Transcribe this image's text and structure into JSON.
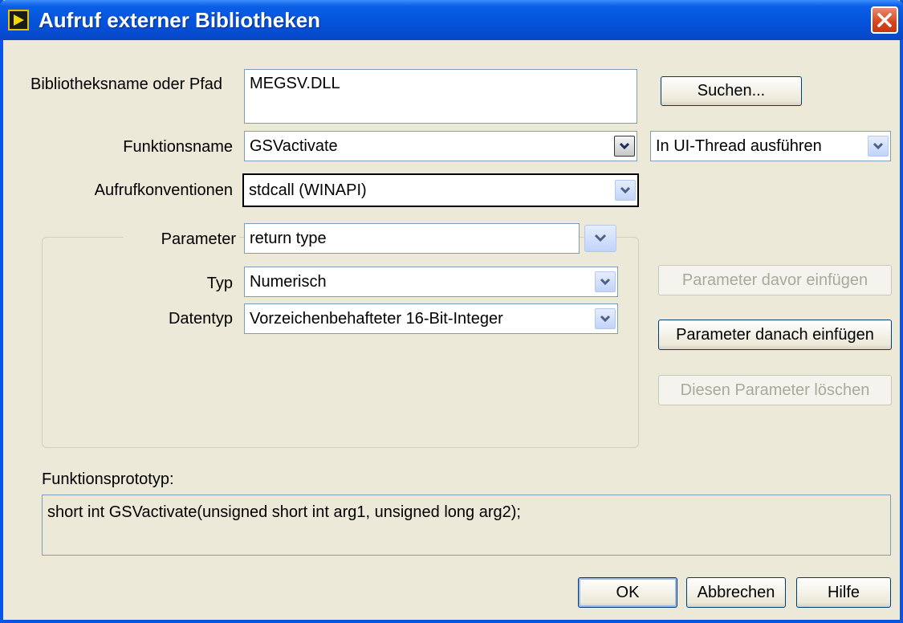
{
  "window": {
    "title": "Aufruf externer Bibliotheken"
  },
  "library": {
    "label": "Bibliotheksname oder Pfad",
    "value": "MEGSV.DLL",
    "browse_label": "Suchen..."
  },
  "function": {
    "label": "Funktionsname",
    "value": "GSVactivate",
    "thread_value": "In UI-Thread ausführen"
  },
  "calling": {
    "label": "Aufrufkonventionen",
    "value": "stdcall (WINAPI)"
  },
  "parameter": {
    "label": "Parameter",
    "value": "return type"
  },
  "type": {
    "label": "Typ",
    "value": "Numerisch"
  },
  "datatype": {
    "label": "Datentyp",
    "value": "Vorzeichenbehafteter 16-Bit-Integer"
  },
  "buttons": {
    "insert_before": "Parameter davor einfügen",
    "insert_after": "Parameter danach einfügen",
    "delete": "Diesen Parameter löschen",
    "ok": "OK",
    "cancel": "Abbrechen",
    "help": "Hilfe"
  },
  "prototype": {
    "label": "Funktionsprototyp:",
    "value": "short int GSVactivate(unsigned short int arg1, unsigned long arg2);"
  }
}
